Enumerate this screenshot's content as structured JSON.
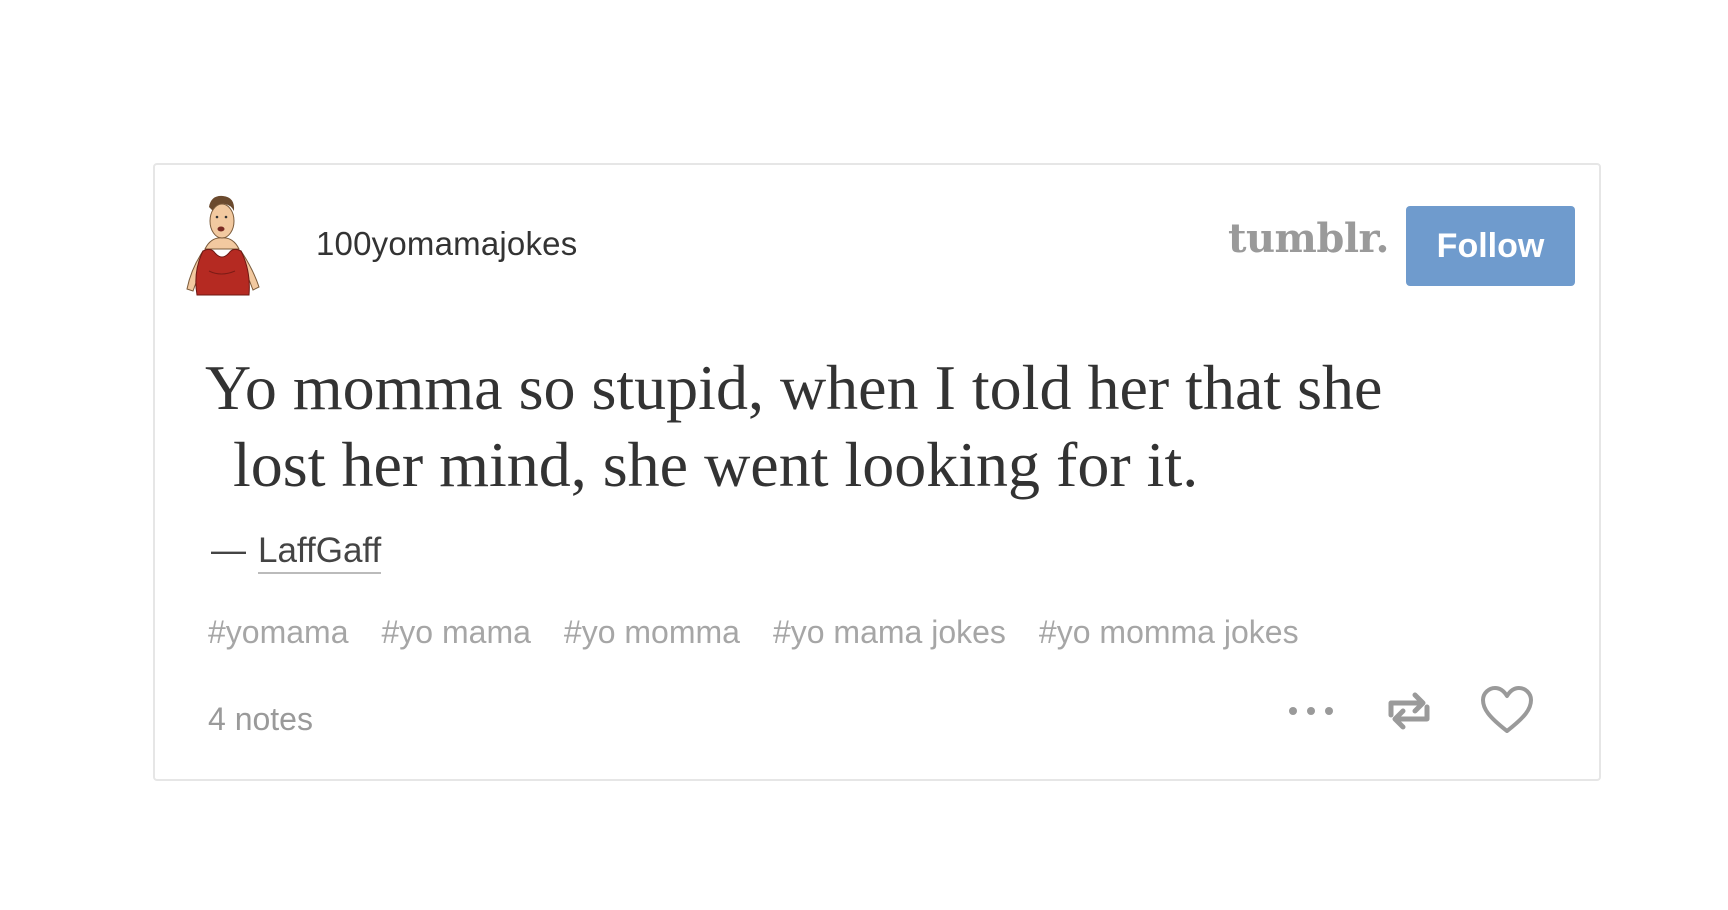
{
  "post": {
    "blog_name": "100yomamajokes",
    "brand": "tumblr.",
    "follow_label": "Follow",
    "quote_line1": "Yo momma so stupid, when I told her that she",
    "quote_line2": "lost her mind, she went looking for it.",
    "source_dash": "—",
    "source_name": "LaffGaff",
    "tags": [
      "#yomama",
      "#yo mama",
      "#yo momma",
      "#yo mama jokes",
      "#yo momma jokes"
    ],
    "notes": "4 notes"
  },
  "icons": {
    "avatar": "cartoon-woman-avatar",
    "more": "more-dots-icon",
    "reblog": "reblog-icon",
    "like": "heart-icon"
  },
  "colors": {
    "follow_button": "#6f9bcd",
    "brand": "#9a9a9a",
    "tags": "#a6a6a6",
    "avatar_dress": "#b52a22"
  }
}
